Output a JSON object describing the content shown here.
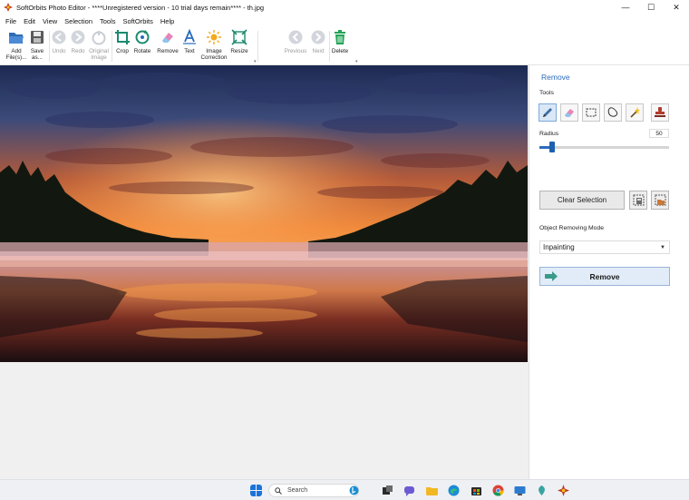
{
  "window": {
    "title": "SoftOrbits Photo Editor - ****Unregistered version - 10 trial days remain**** - th.jpg",
    "controls": [
      "minimize",
      "maximize",
      "close"
    ]
  },
  "menu": [
    "File",
    "Edit",
    "View",
    "Selection",
    "Tools",
    "SoftOrbits",
    "Help"
  ],
  "toolbar": {
    "add_files": "Add\nFile(s)...",
    "save_as": "Save\nas...",
    "undo": "Undo",
    "redo": "Redo",
    "original_image": "Original\nImage",
    "crop": "Crop",
    "rotate": "Rotate",
    "remove": "Remove",
    "text": "Text",
    "image_correction": "Image\nCorrection",
    "resize": "Resize",
    "previous": "Previous",
    "next": "Next",
    "delete": "Delete"
  },
  "panel": {
    "title": "Remove",
    "tools_label": "Tools",
    "tools": [
      "pencil-icon",
      "eraser-icon",
      "rect-select-icon",
      "lasso-icon",
      "magic-wand-icon",
      "stamp-icon"
    ],
    "radius_label": "Radius",
    "radius_value": "50",
    "radius_fraction": 0.1,
    "clear_selection": "Clear Selection",
    "mode_label": "Object Removing Mode",
    "mode_value": "Inpainting",
    "remove_button": "Remove"
  },
  "taskbar": {
    "search_placeholder": "Search"
  },
  "colors": {
    "accent": "#2a6cbd",
    "remove_button_bg": "#e1ecf8"
  }
}
